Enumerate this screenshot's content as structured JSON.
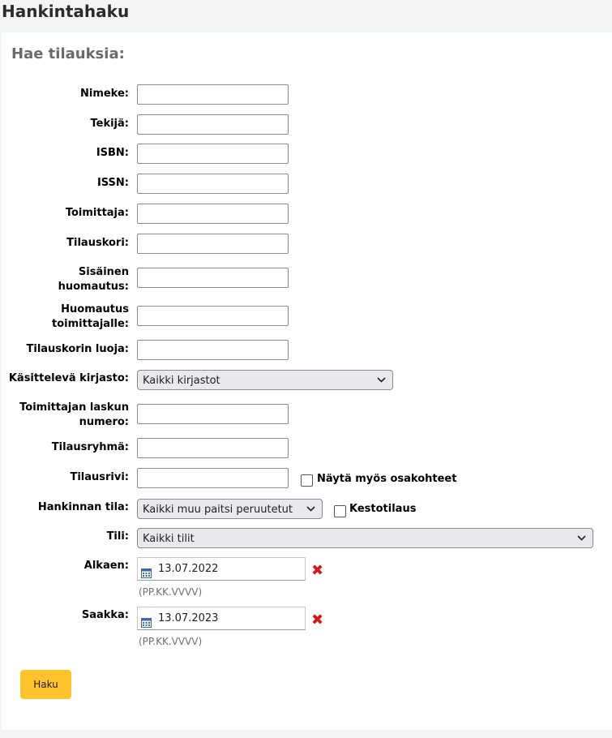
{
  "page": {
    "title": "Hankintahaku"
  },
  "form": {
    "title": "Hae tilauksia:",
    "fields": {
      "nimeke": "Nimeke:",
      "tekija": "Tekijä:",
      "isbn": "ISBN:",
      "issn": "ISSN:",
      "toimittaja": "Toimittaja:",
      "tilauskori": "Tilauskori:",
      "sisainen": "Sisäinen huomautus:",
      "huomautus": "Huomautus toimittajalle:",
      "luoja": "Tilauskorin luoja:",
      "kirjasto": "Käsittelevä kirjasto:",
      "lasku": "Toimittajan laskun numero:",
      "ryhma": "Tilausryhmä:",
      "rivi": "Tilausrivi:",
      "tila": "Hankinnan tila:",
      "tili": "Tili:",
      "alkaen": "Alkaen:",
      "saakka": "Saakka:"
    },
    "selects": {
      "kirjasto": "Kaikki kirjastot",
      "tila": "Kaikki muu paitsi peruutetut",
      "tili": "Kaikki tilit"
    },
    "checkboxes": {
      "osakohteet": "Näytä myös osakohteet",
      "kesto": "Kestotilaus"
    },
    "dates": {
      "alkaen": "13.07.2022",
      "saakka": "13.07.2023",
      "hint": "(PP.KK.VVVV)"
    },
    "submit": "Haku"
  },
  "colors": {
    "accent": "#ffc32b",
    "clear": "#d01a1a"
  }
}
